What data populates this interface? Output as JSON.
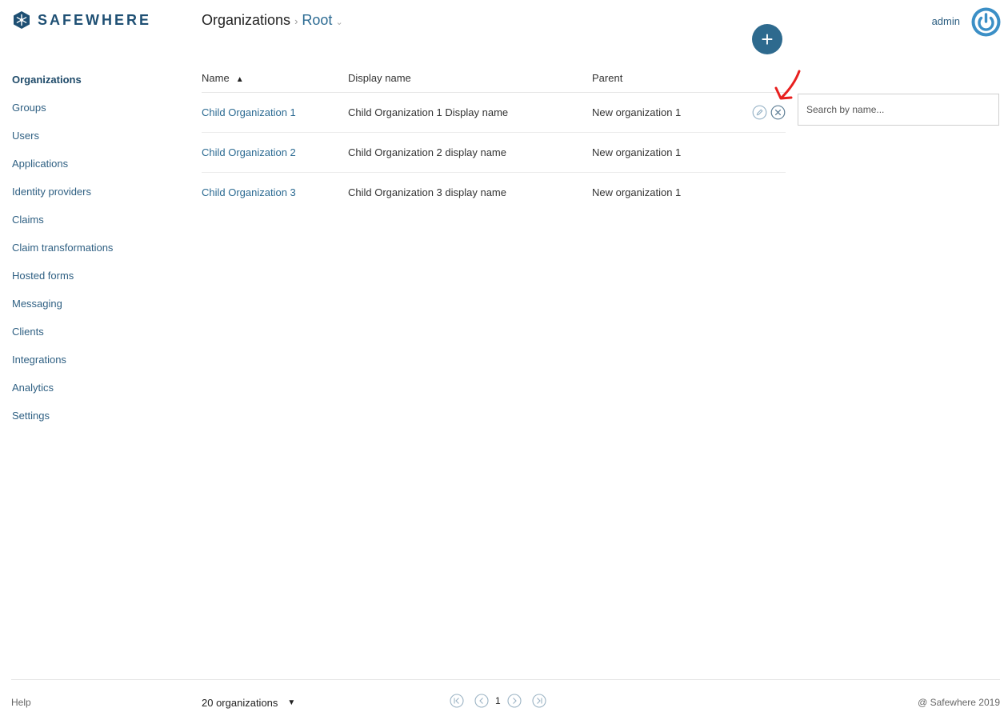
{
  "brand": {
    "name": "SAFEWHERE"
  },
  "breadcrumb": {
    "section": "Organizations",
    "separator": "›",
    "current": "Root",
    "chevron": "⌄"
  },
  "header": {
    "username": "admin",
    "add_button_label": "+"
  },
  "sidebar": {
    "items": [
      {
        "label": "Organizations",
        "active": true
      },
      {
        "label": "Groups"
      },
      {
        "label": "Users"
      },
      {
        "label": "Applications"
      },
      {
        "label": "Identity providers"
      },
      {
        "label": "Claims"
      },
      {
        "label": "Claim transformations"
      },
      {
        "label": "Hosted forms"
      },
      {
        "label": "Messaging"
      },
      {
        "label": "Clients"
      },
      {
        "label": "Integrations"
      },
      {
        "label": "Analytics"
      },
      {
        "label": "Settings"
      }
    ]
  },
  "table": {
    "columns": {
      "name": "Name",
      "display_name": "Display name",
      "parent": "Parent"
    },
    "sort_indicator": "▲",
    "rows": [
      {
        "name": "Child Organization 1",
        "display_name": "Child Organization 1 Display name",
        "parent": "New organization 1"
      },
      {
        "name": "Child Organization 2",
        "display_name": "Child Organization 2 display name",
        "parent": "New organization 1"
      },
      {
        "name": "Child Organization 3",
        "display_name": "Child Organization 3 display name",
        "parent": "New organization 1"
      }
    ]
  },
  "search": {
    "placeholder": "Search by name..."
  },
  "footer": {
    "help": "Help",
    "count_label": "20 organizations",
    "count_caret": "▼",
    "page": "1",
    "copyright": "@ Safewhere 2019"
  },
  "colors": {
    "brand": "#1e4f73",
    "link": "#2b6a92",
    "accent_button": "#2e6a8e",
    "annotation": "#e8201f"
  },
  "icons": {
    "logo": "snowflake-hexagon-icon",
    "avatar": "power-icon",
    "edit": "pencil-icon",
    "delete": "close-circle-icon",
    "first": "first-page-icon",
    "prev": "prev-page-icon",
    "next": "next-page-icon",
    "last": "last-page-icon"
  }
}
